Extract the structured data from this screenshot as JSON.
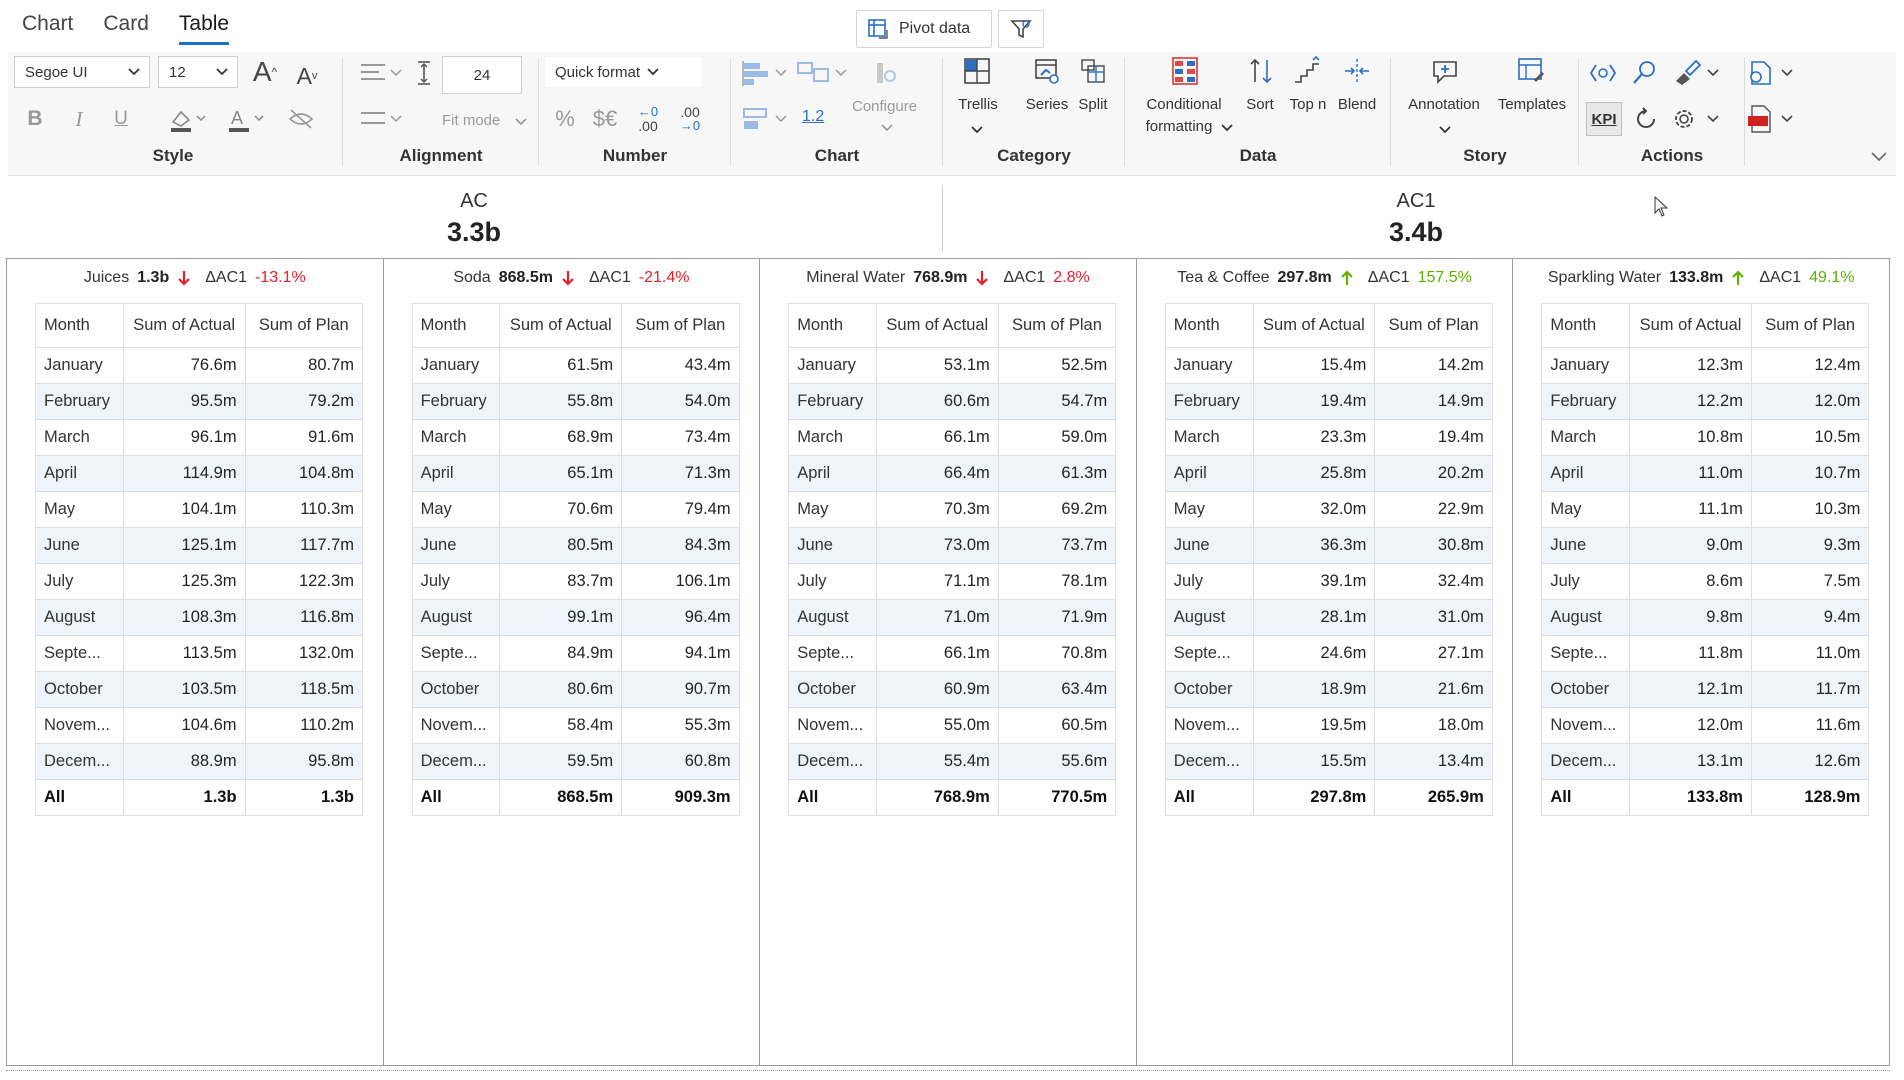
{
  "tabs": [
    "Chart",
    "Card",
    "Table"
  ],
  "active_tab": "Table",
  "pivot_button": "Pivot data",
  "ribbon": {
    "font_name": "Segoe UI",
    "font_size": "12",
    "row_height": "24",
    "quick_format": "Quick format",
    "fit_mode": "Fit mode",
    "configure": "Configure",
    "ratio_label": "1.2",
    "trellis": "Trellis",
    "series": "Series",
    "split": "Split",
    "conditional_line1": "Conditional",
    "conditional_line2": "formatting",
    "sort": "Sort",
    "topn": "Top n",
    "blend": "Blend",
    "annotation": "Annotation",
    "templates": "Templates",
    "kpi": "KPI",
    "groups": {
      "style": "Style",
      "alignment": "Alignment",
      "number": "Number",
      "chart": "Chart",
      "category": "Category",
      "data": "Data",
      "story": "Story",
      "actions": "Actions"
    }
  },
  "summary": [
    {
      "label": "AC",
      "value": "3.3b"
    },
    {
      "label": "AC1",
      "value": "3.4b"
    }
  ],
  "columns": [
    "Month",
    "Sum of Actual",
    "Sum of Plan"
  ],
  "months": [
    "January",
    "February",
    "March",
    "April",
    "May",
    "June",
    "July",
    "August",
    "Septe...",
    "October",
    "Novem...",
    "Decem..."
  ],
  "total_label": "All",
  "delta_label": "ΔAC1",
  "panels": [
    {
      "name": "Juices",
      "value": "1.3b",
      "trend": "down",
      "delta": "-13.1%",
      "delta_sign": "neg",
      "actual": [
        "76.6m",
        "95.5m",
        "96.1m",
        "114.9m",
        "104.1m",
        "125.1m",
        "125.3m",
        "108.3m",
        "113.5m",
        "103.5m",
        "104.6m",
        "88.9m"
      ],
      "plan": [
        "80.7m",
        "79.2m",
        "91.6m",
        "104.8m",
        "110.3m",
        "117.7m",
        "122.3m",
        "116.8m",
        "132.0m",
        "118.5m",
        "110.2m",
        "95.8m"
      ],
      "total_actual": "1.3b",
      "total_plan": "1.3b"
    },
    {
      "name": "Soda",
      "value": "868.5m",
      "trend": "down",
      "delta": "-21.4%",
      "delta_sign": "neg",
      "actual": [
        "61.5m",
        "55.8m",
        "68.9m",
        "65.1m",
        "70.6m",
        "80.5m",
        "83.7m",
        "99.1m",
        "84.9m",
        "80.6m",
        "58.4m",
        "59.5m"
      ],
      "plan": [
        "43.4m",
        "54.0m",
        "73.4m",
        "71.3m",
        "79.4m",
        "84.3m",
        "106.1m",
        "96.4m",
        "94.1m",
        "90.7m",
        "55.3m",
        "60.8m"
      ],
      "total_actual": "868.5m",
      "total_plan": "909.3m"
    },
    {
      "name": "Mineral Water",
      "value": "768.9m",
      "trend": "down",
      "delta": "2.8%",
      "delta_sign": "neg",
      "actual": [
        "53.1m",
        "60.6m",
        "66.1m",
        "66.4m",
        "70.3m",
        "73.0m",
        "71.1m",
        "71.0m",
        "66.1m",
        "60.9m",
        "55.0m",
        "55.4m"
      ],
      "plan": [
        "52.5m",
        "54.7m",
        "59.0m",
        "61.3m",
        "69.2m",
        "73.7m",
        "78.1m",
        "71.9m",
        "70.8m",
        "63.4m",
        "60.5m",
        "55.6m"
      ],
      "total_actual": "768.9m",
      "total_plan": "770.5m"
    },
    {
      "name": "Tea & Coffee",
      "value": "297.8m",
      "trend": "up",
      "delta": "157.5%",
      "delta_sign": "pos",
      "actual": [
        "15.4m",
        "19.4m",
        "23.3m",
        "25.8m",
        "32.0m",
        "36.3m",
        "39.1m",
        "28.1m",
        "24.6m",
        "18.9m",
        "19.5m",
        "15.5m"
      ],
      "plan": [
        "14.2m",
        "14.9m",
        "19.4m",
        "20.2m",
        "22.9m",
        "30.8m",
        "32.4m",
        "31.0m",
        "27.1m",
        "21.6m",
        "18.0m",
        "13.4m"
      ],
      "total_actual": "297.8m",
      "total_plan": "265.9m"
    },
    {
      "name": "Sparkling Water",
      "value": "133.8m",
      "trend": "up",
      "delta": "49.1%",
      "delta_sign": "pos",
      "actual": [
        "12.3m",
        "12.2m",
        "10.8m",
        "11.0m",
        "11.1m",
        "9.0m",
        "8.6m",
        "9.8m",
        "11.8m",
        "12.1m",
        "12.0m",
        "13.1m"
      ],
      "plan": [
        "12.4m",
        "12.0m",
        "10.5m",
        "10.7m",
        "10.3m",
        "9.3m",
        "7.5m",
        "9.4m",
        "11.0m",
        "11.7m",
        "11.6m",
        "12.6m"
      ],
      "total_actual": "133.8m",
      "total_plan": "128.9m"
    }
  ],
  "colors": {
    "accent": "#1a73c8",
    "negative": "#e8202a",
    "positive": "#62b000",
    "row_alt": "#eef4fa"
  }
}
